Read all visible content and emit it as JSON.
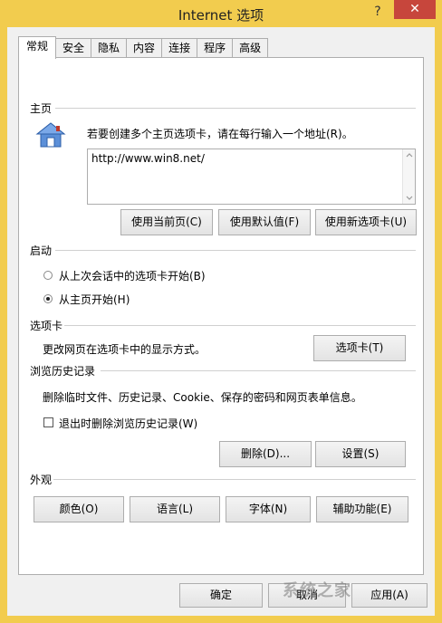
{
  "window": {
    "title": "Internet 选项",
    "help_glyph": "?",
    "close_glyph": "✕",
    "titlebar_color": "#f2cc4e",
    "close_color": "#c7463c"
  },
  "tabs": [
    {
      "label": "常规",
      "active": true
    },
    {
      "label": "安全"
    },
    {
      "label": "隐私"
    },
    {
      "label": "内容"
    },
    {
      "label": "连接"
    },
    {
      "label": "程序"
    },
    {
      "label": "高级"
    }
  ],
  "home": {
    "title": "主页",
    "icon": "house-icon",
    "instruction": "若要创建多个主页选项卡，请在每行输入一个地址(R)。",
    "url_value": "http://www.win8.net/",
    "buttons": [
      "使用当前页(C)",
      "使用默认值(F)",
      "使用新选项卡(U)"
    ]
  },
  "startup": {
    "title": "启动",
    "options": [
      {
        "label": "从上次会话中的选项卡开始(B)",
        "selected": false
      },
      {
        "label": "从主页开始(H)",
        "selected": true
      }
    ]
  },
  "tabs_section": {
    "title": "选项卡",
    "description": "更改网页在选项卡中的显示方式。",
    "button": "选项卡(T)"
  },
  "history": {
    "title": "浏览历史记录",
    "description": "删除临时文件、历史记录、Cookie、保存的密码和网页表单信息。",
    "checkbox_label": "退出时删除浏览历史记录(W)",
    "checkbox_checked": false,
    "delete_button": "删除(D)...",
    "settings_button": "设置(S)"
  },
  "appearance": {
    "title": "外观",
    "buttons": [
      "颜色(O)",
      "语言(L)",
      "字体(N)",
      "辅助功能(E)"
    ]
  },
  "footer": {
    "ok": "确定",
    "cancel": "取消",
    "apply": "应用(A)"
  },
  "watermark": "系统之家"
}
